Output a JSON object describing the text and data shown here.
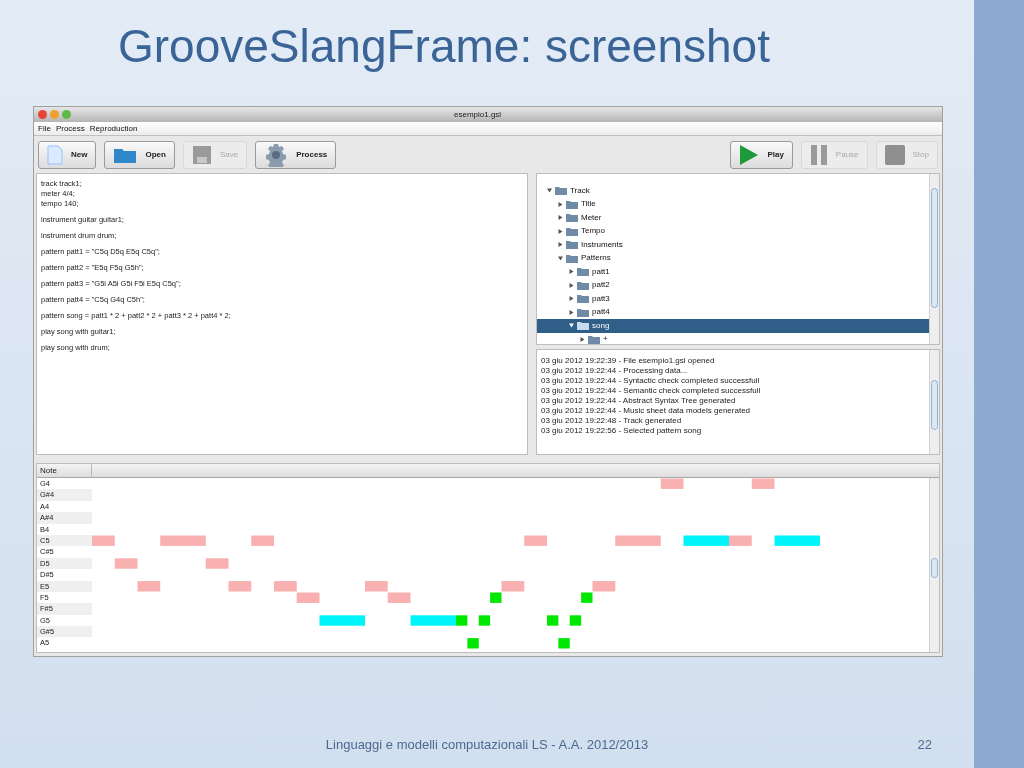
{
  "slide": {
    "title": "GrooveSlangFrame: screenshot",
    "footer": "Linguaggi e modelli computazionali LS - A.A. 2012/2013",
    "page_number": "22"
  },
  "window": {
    "title": "esempio1.gsl"
  },
  "menu": [
    "File",
    "Process",
    "Reproduction"
  ],
  "toolbar_left": [
    {
      "label": "New",
      "kind": "new",
      "disabled": false
    },
    {
      "label": "Open",
      "kind": "open",
      "disabled": false
    },
    {
      "label": "Save",
      "kind": "save",
      "disabled": true
    },
    {
      "label": "Process",
      "kind": "process",
      "disabled": false
    }
  ],
  "toolbar_right": [
    {
      "label": "Play",
      "kind": "play",
      "disabled": false
    },
    {
      "label": "Pause",
      "kind": "pause",
      "disabled": true
    },
    {
      "label": "Stop",
      "kind": "stop",
      "disabled": true
    }
  ],
  "editor": {
    "blocks": [
      [
        "track track1;",
        "meter 4/4;",
        "tempo 140;"
      ],
      [
        "instrument guitar guitar1;"
      ],
      [
        "instrument drum drum;"
      ],
      [
        "pattern patt1 = \"C5q D5q E5q C5q\";"
      ],
      [
        "pattern patt2 = \"E5q F5q G5h\";"
      ],
      [
        "pattern patt3 = \"G5i A5i G5i F5i E5q C5q\";"
      ],
      [
        "pattern patt4 = \"C5q G4q C5h\";"
      ],
      [
        "pattern song = patt1 * 2 + patt2 * 2 + patt3 * 2 + patt4 * 2;"
      ],
      [
        "play song with guitar1;"
      ],
      [
        "play song with drum;"
      ]
    ]
  },
  "tree": [
    {
      "label": "Track",
      "expanded": true,
      "selected": false,
      "children": [
        {
          "label": "Title",
          "expanded": false,
          "selected": false
        },
        {
          "label": "Meter",
          "expanded": false,
          "selected": false
        },
        {
          "label": "Tempo",
          "expanded": false,
          "selected": false
        },
        {
          "label": "Instruments",
          "expanded": false,
          "selected": false
        },
        {
          "label": "Patterns",
          "expanded": true,
          "selected": false,
          "children": [
            {
              "label": "patt1",
              "expanded": false,
              "selected": false
            },
            {
              "label": "patt2",
              "expanded": false,
              "selected": false
            },
            {
              "label": "patt3",
              "expanded": false,
              "selected": false
            },
            {
              "label": "patt4",
              "expanded": false,
              "selected": false
            },
            {
              "label": "song",
              "expanded": true,
              "selected": true,
              "children": [
                {
                  "label": "+",
                  "expanded": false,
                  "selected": false
                }
              ]
            }
          ]
        }
      ]
    }
  ],
  "log": [
    "03 giu 2012 19:22:39 - File esempio1.gsl opened",
    "03 giu 2012 19:22:44 - Processing data...",
    "03 giu 2012 19:22:44 - Syntactic check completed successfull",
    "03 giu 2012 19:22:44 - Semantic check completed successfull",
    "03 giu 2012 19:22:44 - Abstract Syntax Tree generated",
    "03 giu 2012 19:22:44 - Music sheet data models generated",
    "03 giu 2012 19:22:48 - Track generated",
    "03 giu 2012 19:22:56 - Selected pattern song"
  ],
  "piano_roll": {
    "header": "Note",
    "notes": [
      "G4",
      "G#4",
      "A4",
      "A#4",
      "B4",
      "C5",
      "C#5",
      "D5",
      "D#5",
      "E5",
      "F5",
      "F#5",
      "G5",
      "G#5",
      "A5"
    ]
  }
}
